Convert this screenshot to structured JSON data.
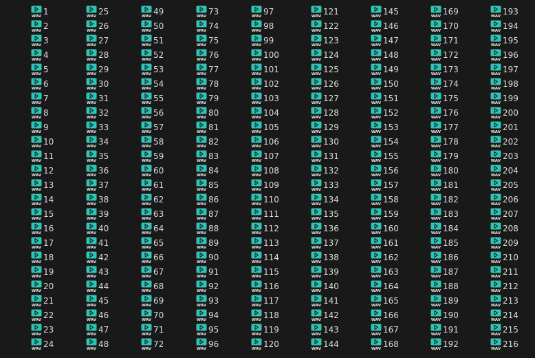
{
  "view": "file-list-columns",
  "icon": "wav-audio-file-icon",
  "icon_colors": {
    "accent": "#2ec4b6",
    "tag_text": "#e8e8e8"
  },
  "icon_tag": "WAV",
  "files": [
    "1",
    "2",
    "3",
    "4",
    "5",
    "6",
    "7",
    "8",
    "9",
    "10",
    "11",
    "12",
    "13",
    "14",
    "15",
    "16",
    "17",
    "18",
    "19",
    "20",
    "21",
    "22",
    "23",
    "24",
    "25",
    "26",
    "27",
    "28",
    "29",
    "30",
    "31",
    "32",
    "33",
    "34",
    "35",
    "36",
    "37",
    "38",
    "39",
    "40",
    "41",
    "42",
    "43",
    "44",
    "45",
    "46",
    "47",
    "48",
    "49",
    "50",
    "51",
    "52",
    "53",
    "54",
    "55",
    "56",
    "57",
    "58",
    "59",
    "60",
    "61",
    "62",
    "63",
    "64",
    "65",
    "66",
    "67",
    "68",
    "69",
    "70",
    "71",
    "72",
    "73",
    "74",
    "75",
    "76",
    "77",
    "78",
    "79",
    "80",
    "81",
    "82",
    "83",
    "84",
    "85",
    "86",
    "87",
    "88",
    "89",
    "90",
    "91",
    "92",
    "93",
    "94",
    "95",
    "96",
    "97",
    "98",
    "99",
    "100",
    "101",
    "102",
    "103",
    "104",
    "105",
    "106",
    "107",
    "108",
    "109",
    "110",
    "111",
    "112",
    "113",
    "114",
    "115",
    "116",
    "117",
    "118",
    "119",
    "120",
    "121",
    "122",
    "123",
    "124",
    "125",
    "126",
    "127",
    "128",
    "129",
    "130",
    "131",
    "132",
    "133",
    "134",
    "135",
    "136",
    "137",
    "138",
    "139",
    "140",
    "141",
    "142",
    "143",
    "144",
    "145",
    "146",
    "147",
    "148",
    "149",
    "150",
    "151",
    "152",
    "153",
    "154",
    "155",
    "156",
    "157",
    "158",
    "159",
    "160",
    "161",
    "162",
    "163",
    "164",
    "165",
    "166",
    "167",
    "168",
    "169",
    "170",
    "171",
    "172",
    "173",
    "174",
    "175",
    "176",
    "177",
    "178",
    "179",
    "180",
    "181",
    "182",
    "183",
    "184",
    "185",
    "186",
    "187",
    "188",
    "189",
    "190",
    "191",
    "192",
    "193",
    "194",
    "195",
    "196",
    "197",
    "198",
    "199",
    "200",
    "201",
    "202",
    "203",
    "204",
    "205",
    "206",
    "207",
    "208",
    "209",
    "210",
    "211",
    "212",
    "213",
    "214",
    "215",
    "216"
  ]
}
